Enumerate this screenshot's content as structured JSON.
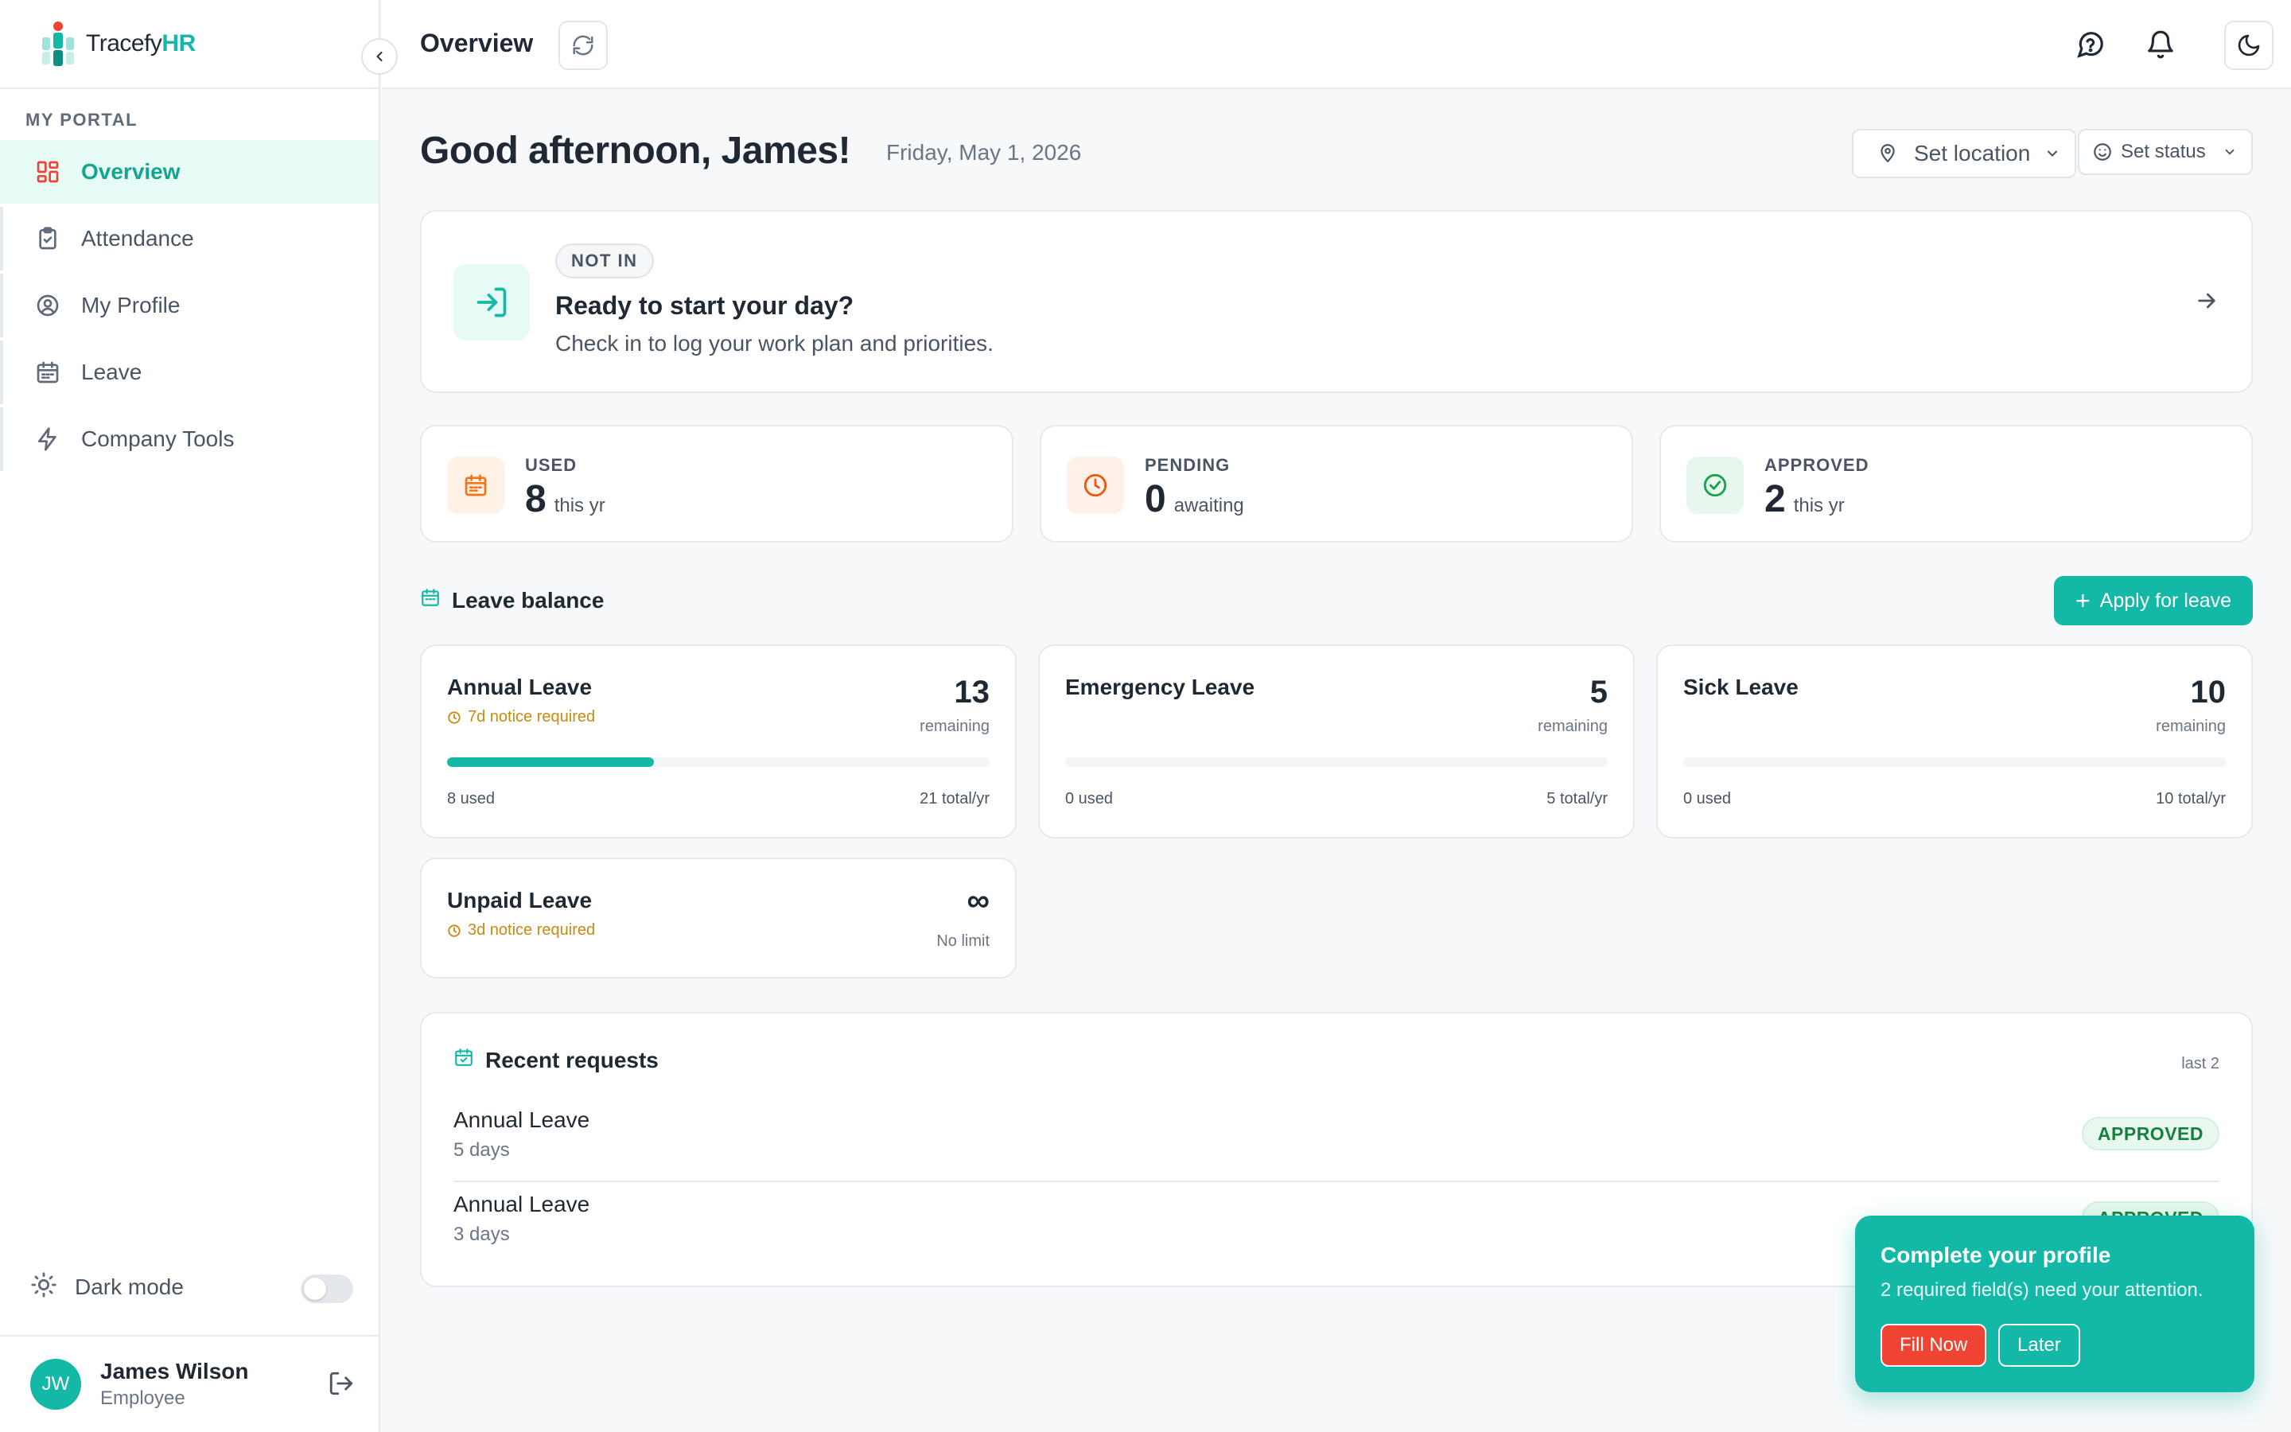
{
  "brand": {
    "name_prefix": "Tracefy",
    "name_suffix": "HR"
  },
  "sidebar": {
    "section_label": "MY PORTAL",
    "items": [
      {
        "label": "Overview",
        "icon": "grid-icon",
        "active": true
      },
      {
        "label": "Attendance",
        "icon": "clipboard-icon",
        "active": false
      },
      {
        "label": "My Profile",
        "icon": "user-circle-icon",
        "active": false
      },
      {
        "label": "Leave",
        "icon": "calendar-icon",
        "active": false
      },
      {
        "label": "Company Tools",
        "icon": "lightning-icon",
        "active": false
      }
    ],
    "dark_mode_label": "Dark mode",
    "user": {
      "initials": "JW",
      "name": "James Wilson",
      "role": "Employee"
    }
  },
  "topbar": {
    "title": "Overview"
  },
  "greeting": {
    "text": "Good afternoon, James!",
    "date": "Friday, May 1, 2026",
    "set_location": "Set location",
    "set_status": "Set status"
  },
  "checkin": {
    "status": "NOT IN",
    "title": "Ready to start your day?",
    "subtitle": "Check in to log your work plan and priorities."
  },
  "stats": [
    {
      "label": "USED",
      "value": "8",
      "unit": "this yr",
      "color": "#f97316"
    },
    {
      "label": "PENDING",
      "value": "0",
      "unit": "awaiting",
      "color": "#ea580c"
    },
    {
      "label": "APPROVED",
      "value": "2",
      "unit": "this yr",
      "color": "#16a34a"
    }
  ],
  "leave_balance": {
    "title": "Leave balance",
    "apply_label": "Apply for leave",
    "cards": [
      {
        "name": "Annual Leave",
        "notice": "7d notice required",
        "remaining": "13",
        "remaining_label": "remaining",
        "used": "8 used",
        "total": "21 total/yr",
        "used_fraction": 0.381
      },
      {
        "name": "Emergency Leave",
        "notice": "",
        "remaining": "5",
        "remaining_label": "remaining",
        "used": "0 used",
        "total": "5 total/yr",
        "used_fraction": 0
      },
      {
        "name": "Sick Leave",
        "notice": "",
        "remaining": "10",
        "remaining_label": "remaining",
        "used": "0 used",
        "total": "10 total/yr",
        "used_fraction": 0
      }
    ],
    "unpaid": {
      "name": "Unpaid Leave",
      "notice": "3d notice required",
      "remaining": "∞",
      "remaining_label": "No limit"
    }
  },
  "recent": {
    "title": "Recent requests",
    "count_label": "last 2",
    "rows": [
      {
        "title": "Annual Leave",
        "sub": "5 days",
        "status": "APPROVED"
      },
      {
        "title": "Annual Leave",
        "sub": "3 days",
        "status": "APPROVED"
      }
    ]
  },
  "toast": {
    "title": "Complete your profile",
    "subtitle": "2 required field(s) need your attention.",
    "primary": "Fill Now",
    "secondary": "Later"
  },
  "colors": {
    "accent": "#14b8a6",
    "danger": "#ef4433",
    "warning": "#c98a12"
  }
}
